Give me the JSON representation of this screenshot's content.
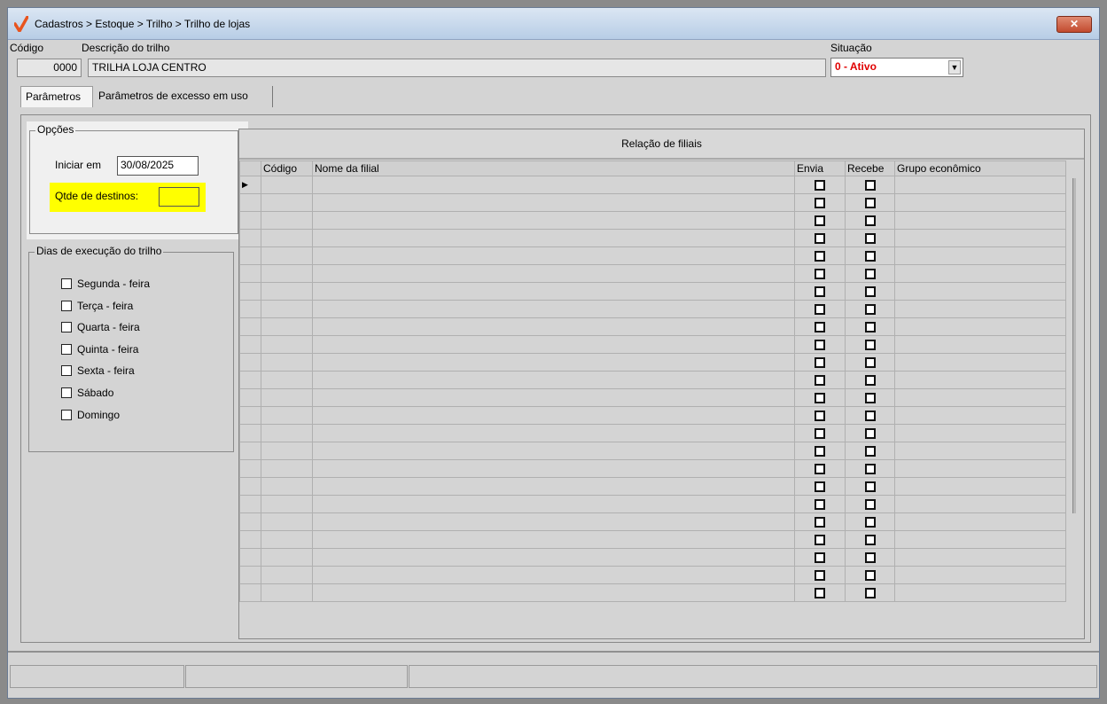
{
  "window": {
    "title": "Cadastros > Estoque > Trilho > Trilho de lojas",
    "close_label": "✕"
  },
  "header": {
    "codigo_label": "Código",
    "codigo_value": "0000",
    "descricao_label": "Descrição do trilho",
    "descricao_value": "TRILHA LOJA CENTRO",
    "situacao_label": "Situação",
    "situacao_value": "0 - Ativo"
  },
  "tabs": [
    {
      "label": "Parâmetros",
      "active": true
    },
    {
      "label": "Parâmetros de excesso em uso",
      "active": false
    }
  ],
  "opcoes": {
    "legend": "Opções",
    "iniciar_label": "Iniciar em",
    "iniciar_value": "30/08/2025",
    "qtde_label": "Qtde de destinos:",
    "qtde_value": ""
  },
  "dias": {
    "legend": "Dias de execução do trilho",
    "items": [
      "Segunda - feira",
      "Terça - feira",
      "Quarta - feira",
      "Quinta - feira",
      "Sexta - feira",
      "Sábado",
      "Domingo"
    ]
  },
  "grid": {
    "title": "Relação de filiais",
    "columns": [
      "Código",
      "Nome da filial",
      "Envia",
      "Recebe",
      "Grupo econômico"
    ],
    "row_count": 24
  },
  "colors": {
    "highlight": "#ffff00",
    "status_active": "#e00000"
  }
}
